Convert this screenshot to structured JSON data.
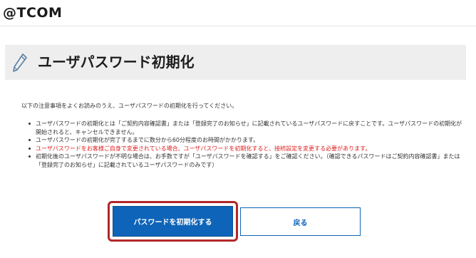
{
  "brand": {
    "logo_text": "@TCOM"
  },
  "page": {
    "title": "ユーザパスワード初期化"
  },
  "intro": "以下の注意事項をよくお読みのうえ、ユーザパスワードの初期化を行ってください。",
  "notes": [
    {
      "text": "ユーザパスワードの初期化とは「ご契約内容確認書」または「登録完了のお知らせ」に記載されているユーザパスワードに戻すことです。ユーザパスワードの初期化が開始されると、キャンセルできません。",
      "warning": false
    },
    {
      "text": "ユーザパスワードの初期化が完了するまでに数分から60分程度のお時間がかかります。",
      "warning": false
    },
    {
      "text": "ユーザパスワードをお客様ご自身で変更されている場合、ユーザパスワードを初期化すると、接続設定を変更する必要があります。",
      "warning": true
    },
    {
      "text": "初期化後のユーザパスワードが不明な場合は、お手数ですが「ユーザパスワードを確認する」をご確認ください。（確認できるパスワードはご契約内容確認書」または「登録完了のお知らせ」に記載されているユーザパスワードのみです）",
      "warning": false
    }
  ],
  "actions": {
    "reset_label": "パスワードを初期化する",
    "back_label": "戻る"
  },
  "colors": {
    "primary": "#0e64b8",
    "warning": "#e02020",
    "highlight": "#b3262a",
    "title_bg": "#eeeeee"
  },
  "icons": {
    "title_icon": "pencil-icon"
  }
}
